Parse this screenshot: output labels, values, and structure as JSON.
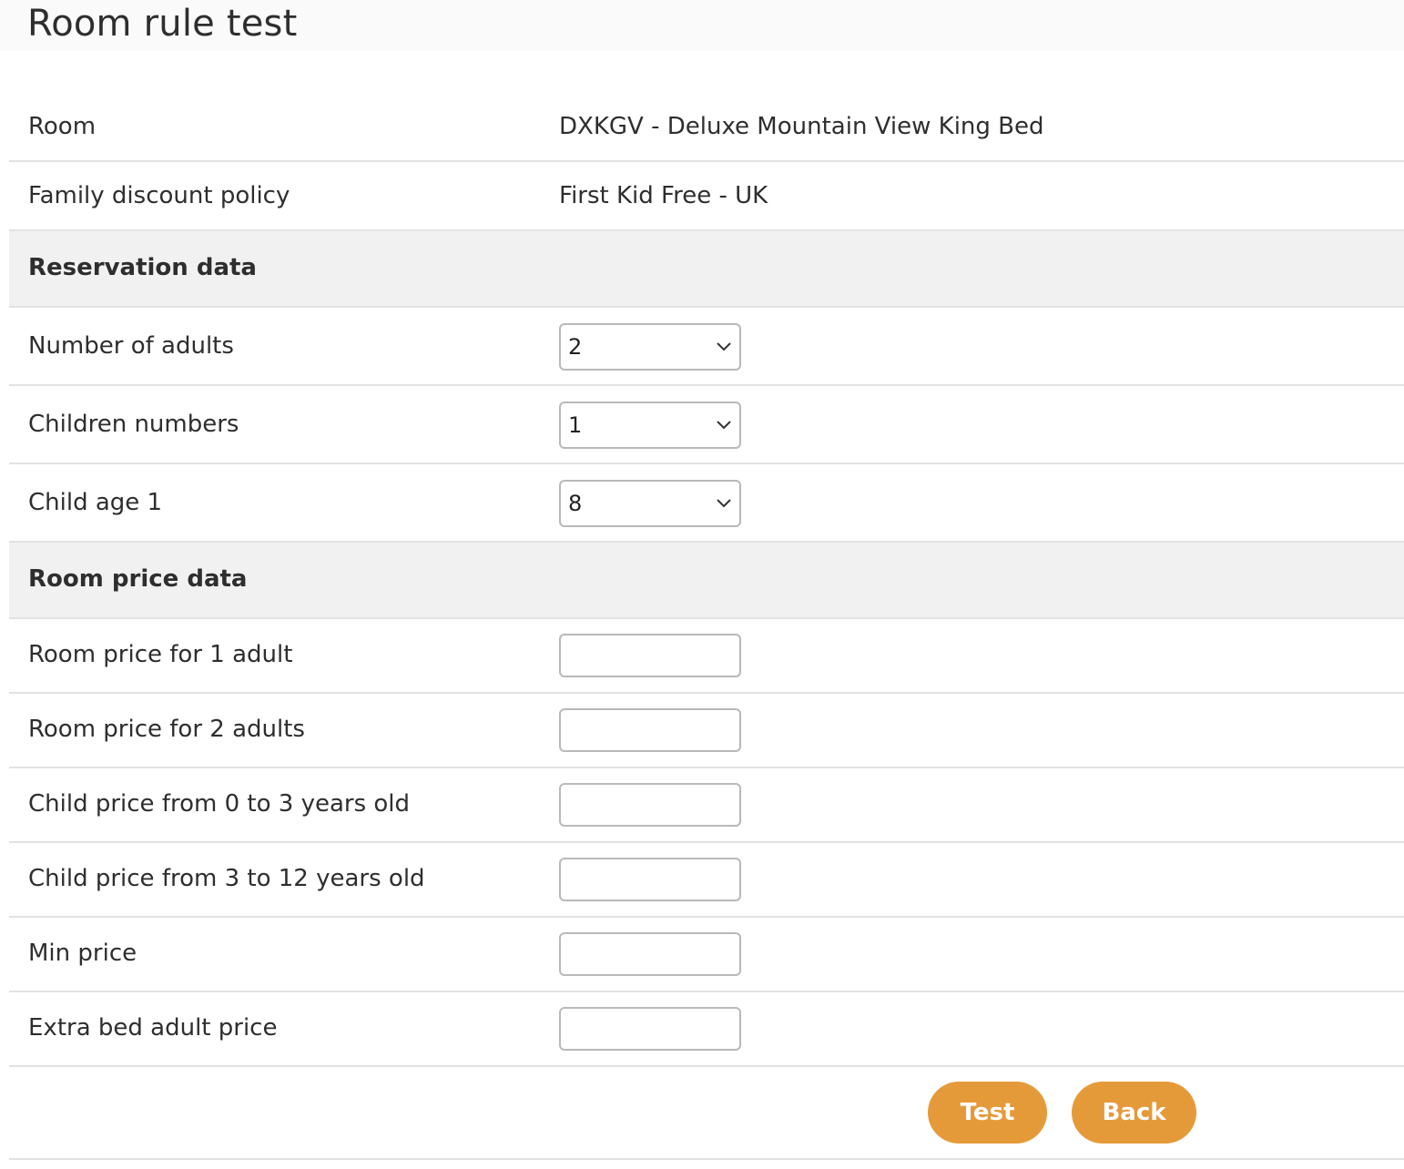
{
  "page": {
    "title": "Room rule test"
  },
  "info": {
    "room_label": "Room",
    "room_value": "DXKGV - Deluxe Mountain View King Bed",
    "policy_label": "Family discount policy",
    "policy_value": "First Kid Free - UK"
  },
  "reservation": {
    "section_title": "Reservation data",
    "adults_label": "Number of adults",
    "adults_value": "2",
    "children_label": "Children numbers",
    "children_value": "1",
    "child_age_label": "Child age 1",
    "child_age_value": "8"
  },
  "price": {
    "section_title": "Room price data",
    "fields": [
      {
        "label": "Room price for 1 adult",
        "value": ""
      },
      {
        "label": "Room price for 2 adults",
        "value": ""
      },
      {
        "label": "Child price from 0 to 3 years old",
        "value": ""
      },
      {
        "label": "Child price from 3 to 12 years old",
        "value": ""
      },
      {
        "label": "Min price",
        "value": ""
      },
      {
        "label": "Extra bed adult price",
        "value": ""
      }
    ]
  },
  "actions": {
    "test_label": "Test",
    "back_label": "Back"
  },
  "colors": {
    "accent": "#e59a3a",
    "section_bg": "#f1f1f1",
    "divider": "#e2e2e2"
  },
  "icons": {
    "dropdown": "chevron-down-icon"
  }
}
